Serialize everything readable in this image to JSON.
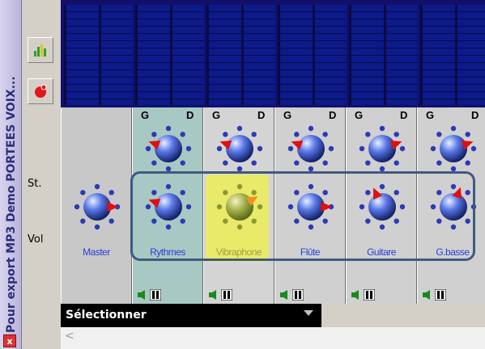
{
  "window": {
    "title": "Pour export MP3 Demo PORTEES VOIX...",
    "close_glyph": "x"
  },
  "sidebar": {
    "st_label": "St.",
    "vol_label": "Vol",
    "tools": [
      {
        "icon": "equalizer-icon"
      },
      {
        "icon": "red-record-icon"
      }
    ]
  },
  "gd": {
    "g": "G",
    "d": "D"
  },
  "channels": [
    {
      "name": "Master",
      "color": "#2a3dd8",
      "bg": "#c8c8c8",
      "has_gd": false,
      "has_pan": false,
      "vol_dir": 0,
      "style": "blue"
    },
    {
      "name": "Rythmes",
      "color": "#2a3dd8",
      "bg": "#a8c8c4",
      "has_gd": true,
      "has_pan": true,
      "pan_dir": 200,
      "vol_dir": 200,
      "style": "blue"
    },
    {
      "name": "Vibraphone",
      "color": "#a0a040",
      "bg": "#d4d4d4",
      "has_gd": true,
      "has_pan": true,
      "pan_dir": 200,
      "vol_dir": 330,
      "style": "yellow"
    },
    {
      "name": "Flûte",
      "color": "#2a3dd8",
      "bg": "#d0d0d0",
      "has_gd": true,
      "has_pan": true,
      "pan_dir": 200,
      "vol_dir": 0,
      "style": "blue"
    },
    {
      "name": "Guitare",
      "color": "#2a3dd8",
      "bg": "#d0d0d0",
      "has_gd": true,
      "has_pan": true,
      "pan_dir": 340,
      "vol_dir": 245,
      "style": "blue"
    },
    {
      "name": "G.basse",
      "color": "#2a3dd8",
      "bg": "#d0d0d0",
      "has_gd": true,
      "has_pan": true,
      "pan_dir": 340,
      "vol_dir": 290,
      "style": "blue"
    }
  ],
  "selector": {
    "label": "Sélectionner"
  },
  "scroll": {
    "left_glyph": "<"
  }
}
